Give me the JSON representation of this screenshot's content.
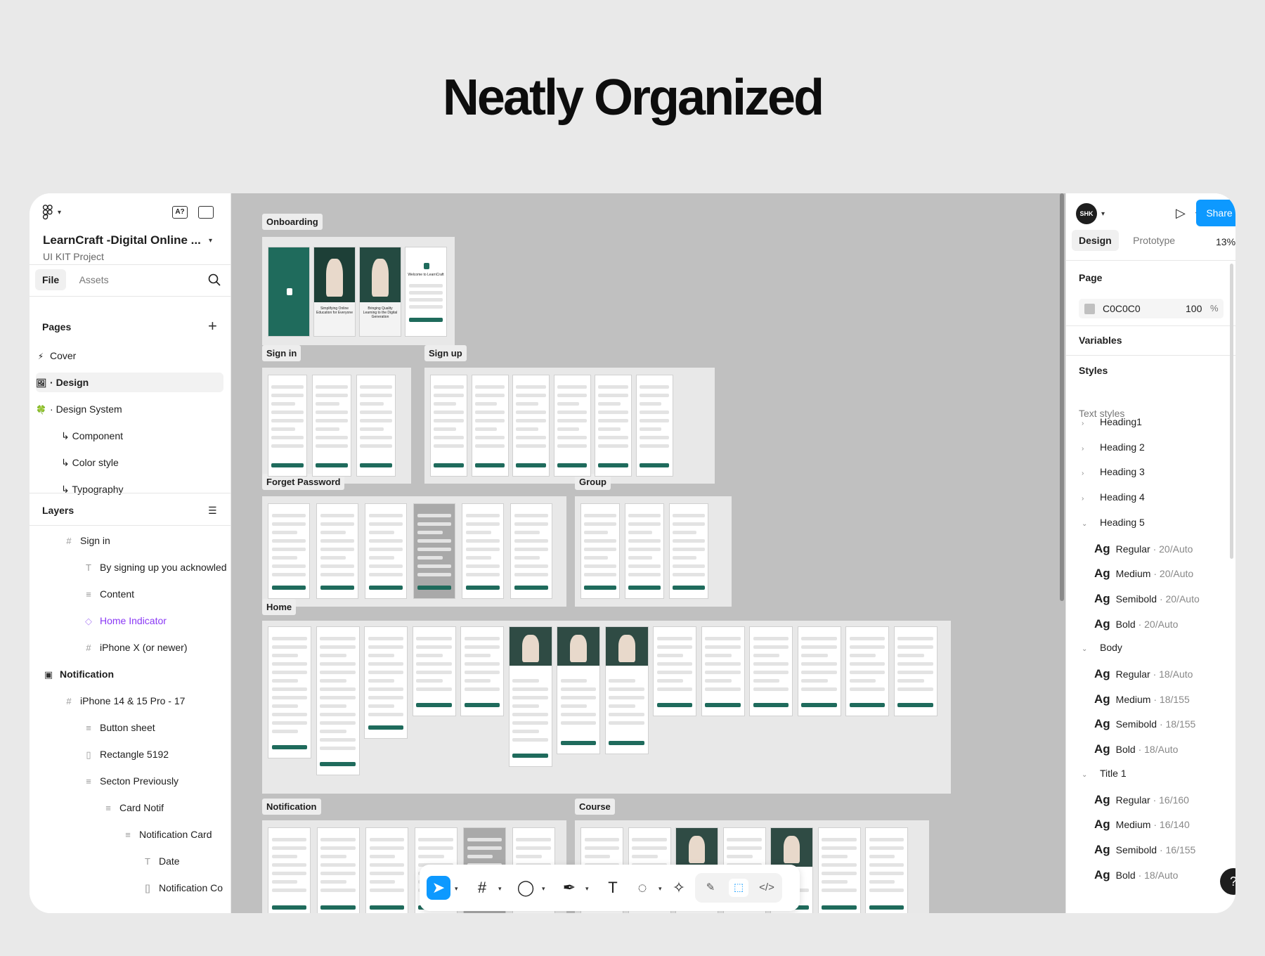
{
  "headline": "Neatly Organized",
  "left": {
    "project_title": "LearnCraft -Digital Online ...",
    "project_sub": "UI KIT Project",
    "tabs": [
      "File",
      "Assets"
    ],
    "pages_header": "Pages",
    "pages": [
      {
        "icon": "⚡",
        "label": "Cover"
      },
      {
        "icon": "🖼",
        "label": "Design"
      },
      {
        "icon": "🍀",
        "label": "Design System"
      },
      {
        "icon": "↳",
        "label": "Component"
      },
      {
        "icon": "↳",
        "label": "Color style"
      },
      {
        "icon": "↳",
        "label": "Typography"
      }
    ],
    "layers_header": "Layers",
    "layers": [
      {
        "icon": "#",
        "label": "Sign in"
      },
      {
        "icon": "T",
        "label": "By signing up you acknowled"
      },
      {
        "icon": "≡",
        "label": "Content"
      },
      {
        "icon": "◇",
        "label": "Home Indicator"
      },
      {
        "icon": "#",
        "label": "iPhone X (or newer)"
      },
      {
        "icon": "▣",
        "label": "Notification"
      },
      {
        "icon": "#",
        "label": "iPhone 14 & 15 Pro - 17"
      },
      {
        "icon": "≡",
        "label": "Button sheet"
      },
      {
        "icon": "▯",
        "label": "Rectangle 5192"
      },
      {
        "icon": "≡",
        "label": "Secton Previously"
      },
      {
        "icon": "≡",
        "label": "Card Notif"
      },
      {
        "icon": "≡",
        "label": "Notification Card"
      },
      {
        "icon": "T",
        "label": "Date"
      },
      {
        "icon": "[]",
        "label": "Notification Co"
      }
    ]
  },
  "canvas": {
    "sections": [
      "Onboarding",
      "Sign in",
      "Sign up",
      "Forget Password",
      "Group",
      "Home",
      "Notification",
      "Course"
    ],
    "onboarding_captions": [
      "Simplifying Online Education for Everyone",
      "Bringing Quality Learning to the Digital Generation",
      "Welcome to LearnCraft"
    ]
  },
  "right": {
    "avatar": "SHK",
    "share": "Share",
    "tabs": [
      "Design",
      "Prototype"
    ],
    "zoom": "13%",
    "page_header": "Page",
    "page_color": "C0C0C0",
    "page_opacity": "100",
    "page_opacity_unit": "%",
    "variables_header": "Variables",
    "styles_header": "Styles",
    "text_styles_label": "Text styles",
    "styles": [
      {
        "type": "group",
        "expanded": false,
        "label": "Heading1"
      },
      {
        "type": "group",
        "expanded": false,
        "label": "Heading 2"
      },
      {
        "type": "group",
        "expanded": false,
        "label": "Heading 3"
      },
      {
        "type": "group",
        "expanded": false,
        "label": "Heading 4"
      },
      {
        "type": "group",
        "expanded": true,
        "label": "Heading 5"
      },
      {
        "type": "item",
        "label": "Regular",
        "meta": "· 20/Auto"
      },
      {
        "type": "item",
        "label": "Medium",
        "meta": "· 20/Auto"
      },
      {
        "type": "item",
        "label": "Semibold",
        "meta": "· 20/Auto"
      },
      {
        "type": "item",
        "label": "Bold",
        "meta": "· 20/Auto"
      },
      {
        "type": "group",
        "expanded": true,
        "label": "Body"
      },
      {
        "type": "item",
        "label": "Regular",
        "meta": "· 18/Auto"
      },
      {
        "type": "item",
        "label": "Medium",
        "meta": "· 18/155"
      },
      {
        "type": "item",
        "label": "Semibold",
        "meta": "· 18/155"
      },
      {
        "type": "item",
        "label": "Bold",
        "meta": "· 18/Auto"
      },
      {
        "type": "group",
        "expanded": true,
        "label": "Title 1"
      },
      {
        "type": "item",
        "label": "Regular",
        "meta": "· 16/160"
      },
      {
        "type": "item",
        "label": "Medium",
        "meta": "· 16/140"
      },
      {
        "type": "item",
        "label": "Semibold",
        "meta": "· 16/155"
      },
      {
        "type": "item",
        "label": "Bold",
        "meta": "· 18/Auto"
      }
    ],
    "ag": "Ag",
    "help": "?"
  },
  "colors": {
    "accent": "#0d99ff",
    "brand_green": "#1f6b5c",
    "canvas": "#c0c0c0",
    "purple": "#8a38f5"
  }
}
